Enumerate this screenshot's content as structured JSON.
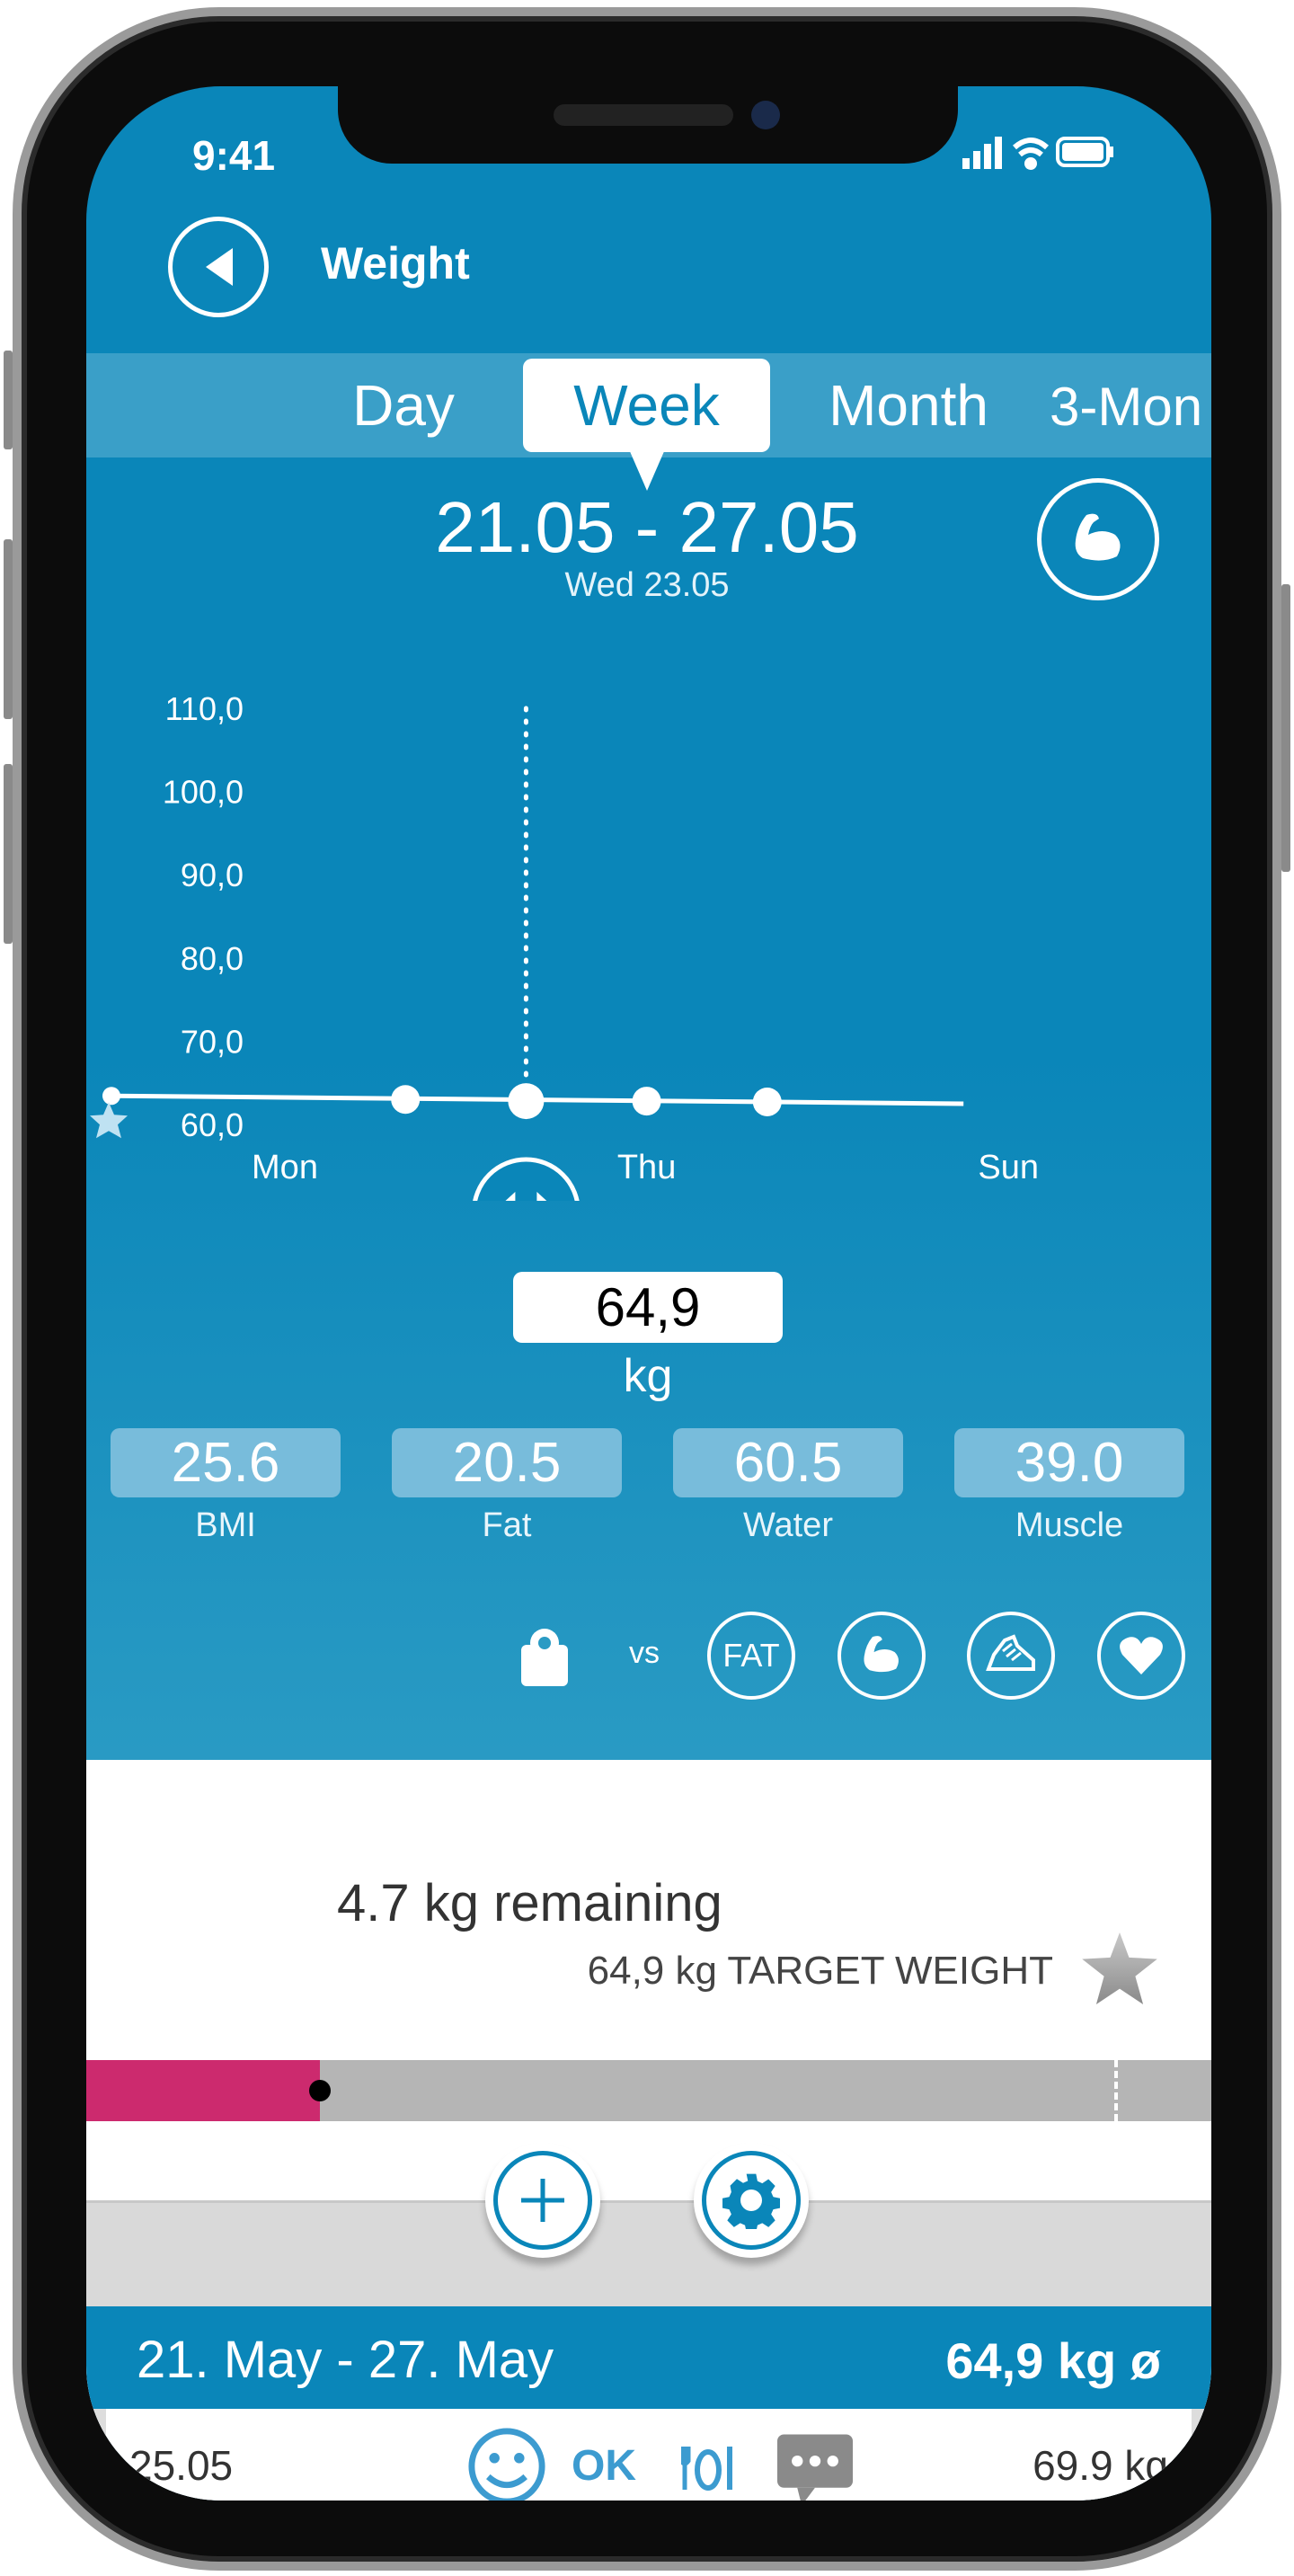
{
  "status_bar": {
    "time": "9:41"
  },
  "header": {
    "title": "Weight",
    "back_icon": "back-arrow-icon"
  },
  "tabs": [
    {
      "label": "Day",
      "active": false
    },
    {
      "label": "Week",
      "active": true
    },
    {
      "label": "Month",
      "active": false
    },
    {
      "label": "3-Mon",
      "active": false
    }
  ],
  "date_range": "21.05 - 27.05",
  "selected_day": "Wed 23.05",
  "chart_data": {
    "type": "line",
    "categories": [
      "Mon",
      "Tue",
      "Wed",
      "Thu",
      "Fri",
      "Sat",
      "Sun"
    ],
    "x_tick_labels": [
      "Mon",
      "Thu",
      "Sun"
    ],
    "y_tick_labels": [
      "110,0",
      "100,0",
      "90,0",
      "80,0",
      "70,0",
      "60,0"
    ],
    "ylim": [
      60,
      110
    ],
    "series": [
      {
        "points": [
          {
            "x": "Tue",
            "y": 63
          },
          {
            "x": "Wed",
            "y": 62.8
          },
          {
            "x": "Thu",
            "y": 62.8
          },
          {
            "x": "Fri",
            "y": 62.7
          }
        ]
      }
    ],
    "selected": "Wed",
    "grid": false
  },
  "current": {
    "value": "64,9",
    "unit": "kg"
  },
  "metrics": [
    {
      "value": "25.6",
      "label": "BMI"
    },
    {
      "value": "20.5",
      "label": "Fat"
    },
    {
      "value": "60.5",
      "label": "Water"
    },
    {
      "value": "39.0",
      "label": "Muscle"
    }
  ],
  "compare": {
    "vs_label": "vs",
    "fat_label": "FAT"
  },
  "goal": {
    "remaining": "4.7 kg remaining",
    "target": "64,9 kg TARGET WEIGHT",
    "progress_percent": 25
  },
  "colors": {
    "primary": "#0a86b9",
    "progress": "#cc2a6e",
    "track": "#b5b5b5"
  },
  "summary": {
    "range": "21. May - 27. May",
    "average": "64,9 kg ø"
  },
  "entries": [
    {
      "date": "25.05",
      "mood": "OK",
      "weight": "69.9 kg"
    }
  ]
}
